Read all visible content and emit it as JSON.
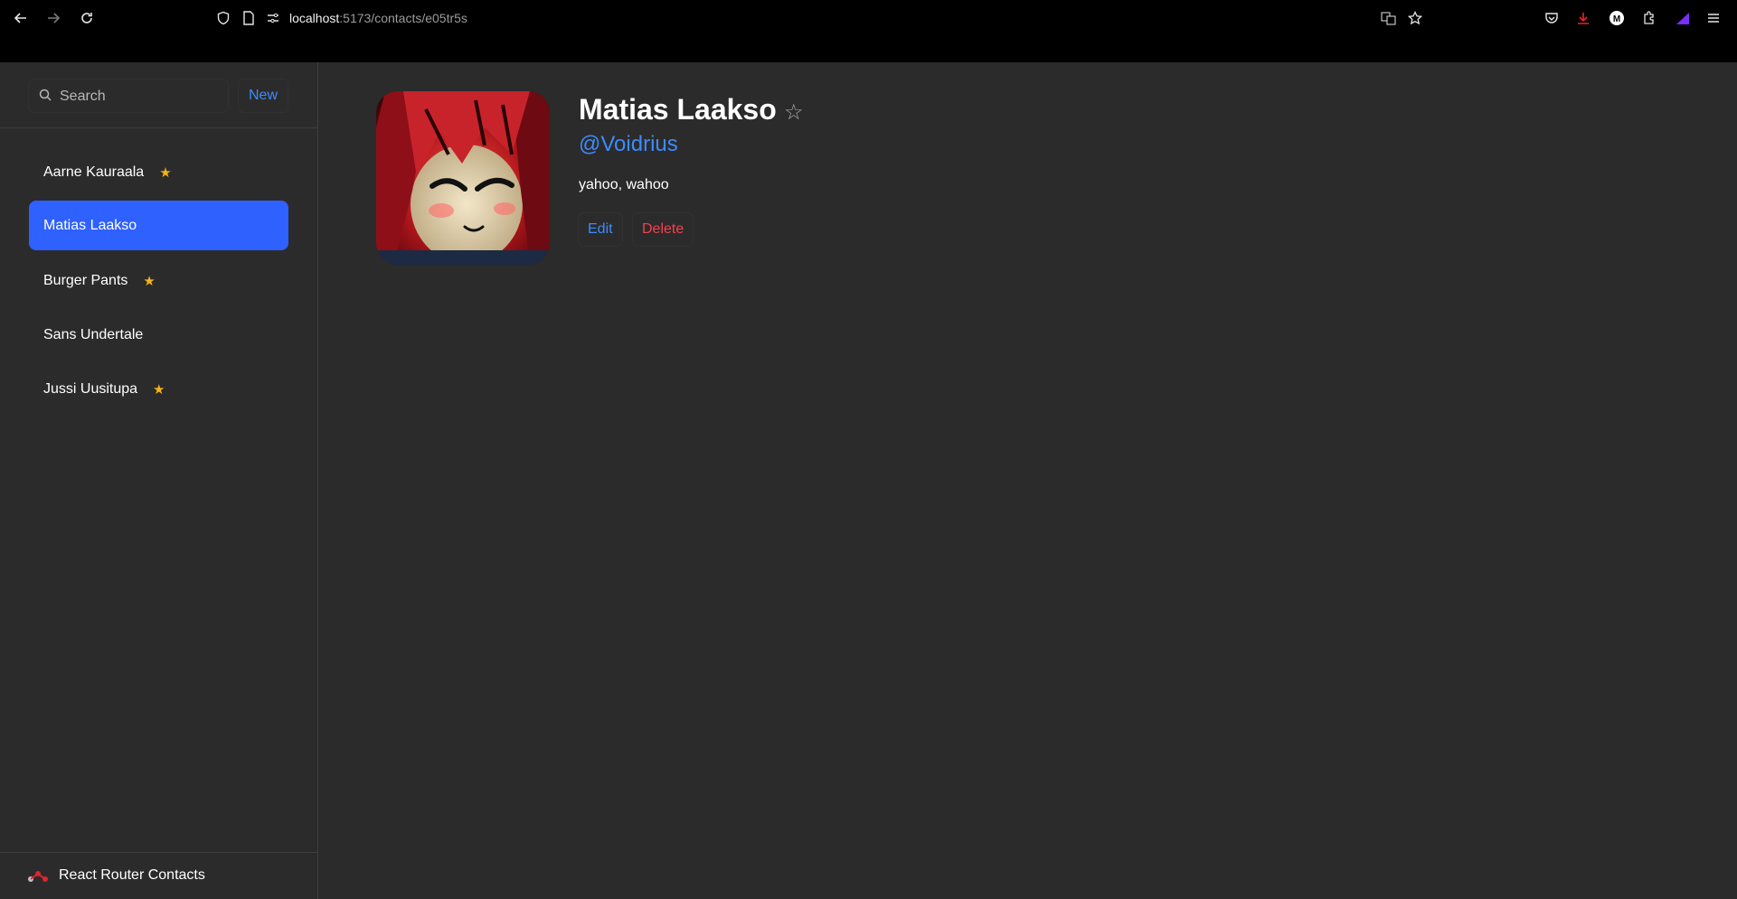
{
  "browser": {
    "url_host": "localhost",
    "url_path": ":5173/contacts/e05tr5s"
  },
  "sidebar": {
    "search": {
      "placeholder": "Search",
      "value": ""
    },
    "new_label": "New",
    "contacts": [
      {
        "name": "Aarne Kauraala",
        "favorite": true,
        "active": false
      },
      {
        "name": "Matias Laakso",
        "favorite": false,
        "active": true
      },
      {
        "name": "Burger Pants",
        "favorite": true,
        "active": false
      },
      {
        "name": "Sans Undertale",
        "favorite": false,
        "active": false
      },
      {
        "name": "Jussi Uusitupa",
        "favorite": true,
        "active": false
      }
    ],
    "star_glyph": "★",
    "footer": "React Router Contacts"
  },
  "contact": {
    "name": "Matias Laakso",
    "fav_glyph": "☆",
    "handle": "@Voidrius",
    "notes": "yahoo, wahoo",
    "edit_label": "Edit",
    "delete_label": "Delete"
  },
  "colors": {
    "accent": "#2f61ff",
    "link": "#3d8bff",
    "danger": "#f44250",
    "star": "#f4b31a",
    "background": "#2b2b2b"
  }
}
